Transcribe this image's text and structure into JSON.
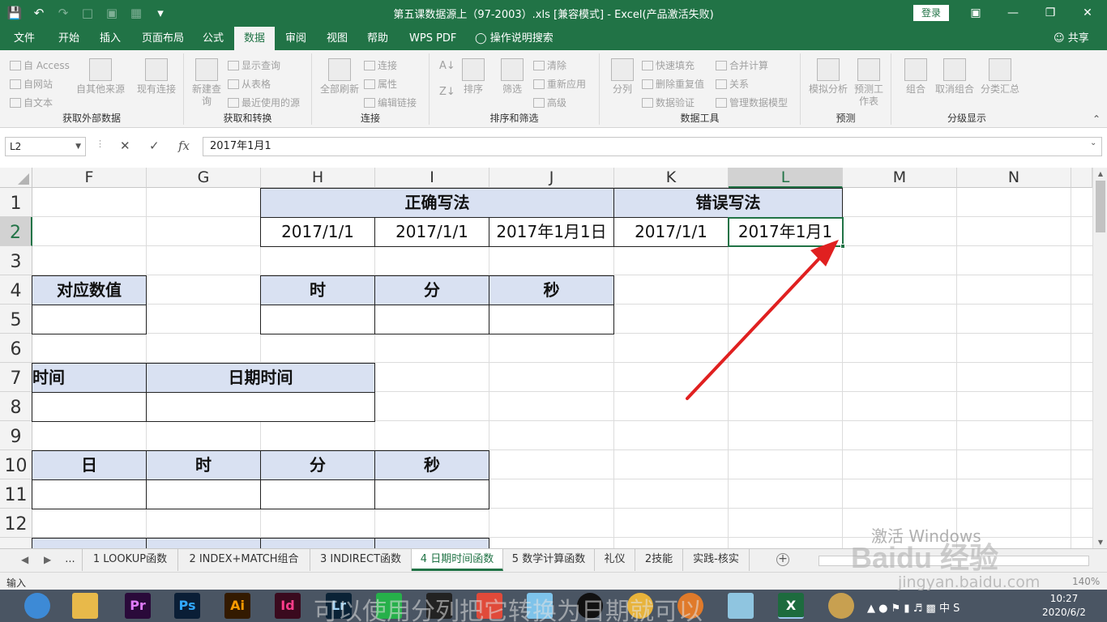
{
  "window": {
    "title": "第五课数据源上（97-2003）.xls  [兼容模式]  -  Excel(产品激活失败)",
    "login_label": "登录",
    "controls": [
      "ribbon-display-icon",
      "minimize-icon",
      "maximize-icon",
      "close-icon"
    ]
  },
  "quick_access": [
    "save-icon",
    "undo-icon",
    "redo-icon",
    "new-icon",
    "print-preview-icon",
    "table-icon",
    "customize-icon"
  ],
  "menu": {
    "tabs": [
      "文件",
      "开始",
      "插入",
      "页面布局",
      "公式",
      "数据",
      "审阅",
      "视图",
      "帮助",
      "WPS PDF"
    ],
    "active": "数据",
    "tell_me": "操作说明搜索",
    "share": "共享"
  },
  "ribbon": {
    "groups": [
      {
        "label": "获取外部数据",
        "items": [
          "自 Access",
          "自网站",
          "自文本",
          "自其他来源",
          "现有连接"
        ]
      },
      {
        "label": "获取和转换",
        "items": [
          "新建查询",
          "显示查询",
          "从表格",
          "最近使用的源"
        ]
      },
      {
        "label": "连接",
        "items": [
          "全部刷新",
          "连接",
          "属性",
          "编辑链接"
        ]
      },
      {
        "label": "排序和筛选",
        "items": [
          "排序",
          "筛选",
          "清除",
          "重新应用",
          "高级"
        ]
      },
      {
        "label": "数据工具",
        "items": [
          "分列",
          "快速填充",
          "删除重复值",
          "数据验证",
          "合并计算",
          "关系",
          "管理数据模型"
        ]
      },
      {
        "label": "预测",
        "items": [
          "模拟分析",
          "预测工作表"
        ]
      },
      {
        "label": "分级显示",
        "items": [
          "组合",
          "取消组合",
          "分类汇总"
        ]
      }
    ]
  },
  "formula_bar": {
    "name_box": "L2",
    "formula": "2017年1月1"
  },
  "sheet": {
    "columns": [
      "F",
      "G",
      "H",
      "I",
      "J",
      "K",
      "L",
      "M",
      "N"
    ],
    "selected_column": "L",
    "rows": [
      "1",
      "2",
      "3",
      "4",
      "5",
      "6",
      "7",
      "8",
      "9",
      "10",
      "11",
      "12"
    ],
    "selected_row": "2",
    "cells": {
      "correct_header": "正确写法",
      "wrong_header": "错误写法",
      "h2": "2017/1/1",
      "i2": "2017/1/1",
      "j2": "2017年1月1日",
      "k2": "2017/1/1",
      "l2": "2017年1月1",
      "value_header": "对应数值",
      "hour_header": "时",
      "minute_header": "分",
      "second_header": "秒",
      "time_header": "时间",
      "datetime_header": "日期时间",
      "day_header": "日",
      "hour_header_2": "时",
      "minute_header_2": "分",
      "second_header_2": "秒"
    }
  },
  "sheet_tabs": {
    "items": [
      "...",
      "1 LOOKUP函数",
      "2 INDEX+MATCH组合",
      "3 INDIRECT函数",
      "4 日期时间函数",
      "5 数学计算函数",
      "礼仪",
      "2技能",
      "实践-核实"
    ],
    "active": "4 日期时间函数"
  },
  "status_bar": {
    "mode": "输入",
    "zoom": "140%"
  },
  "taskbar": {
    "apps": [
      "browser",
      "file-explorer",
      "premiere",
      "photoshop",
      "illustrator",
      "indesign",
      "lightroom",
      "green-app",
      "video-editor",
      "colored-app",
      "bird-app",
      "qq",
      "chrome",
      "fox-app",
      "glass-app",
      "excel",
      "face-app"
    ],
    "app_labels": [
      "Pr",
      "Ps",
      "Ai",
      "Id",
      "Lr"
    ],
    "clock_time": "10:27",
    "clock_date": "2020/6/2",
    "ime": "中"
  },
  "overlays": {
    "activate_windows": "激活 Windows",
    "baidu_jingyan": "Baidu 经验",
    "baidu_url": "jingyan.baidu.com",
    "caption": "可以使用分列把它转换为日期就可以"
  },
  "colors": {
    "excel_green": "#217346",
    "header_fill": "#d9e1f2",
    "annotation_arrow": "#e02020"
  }
}
